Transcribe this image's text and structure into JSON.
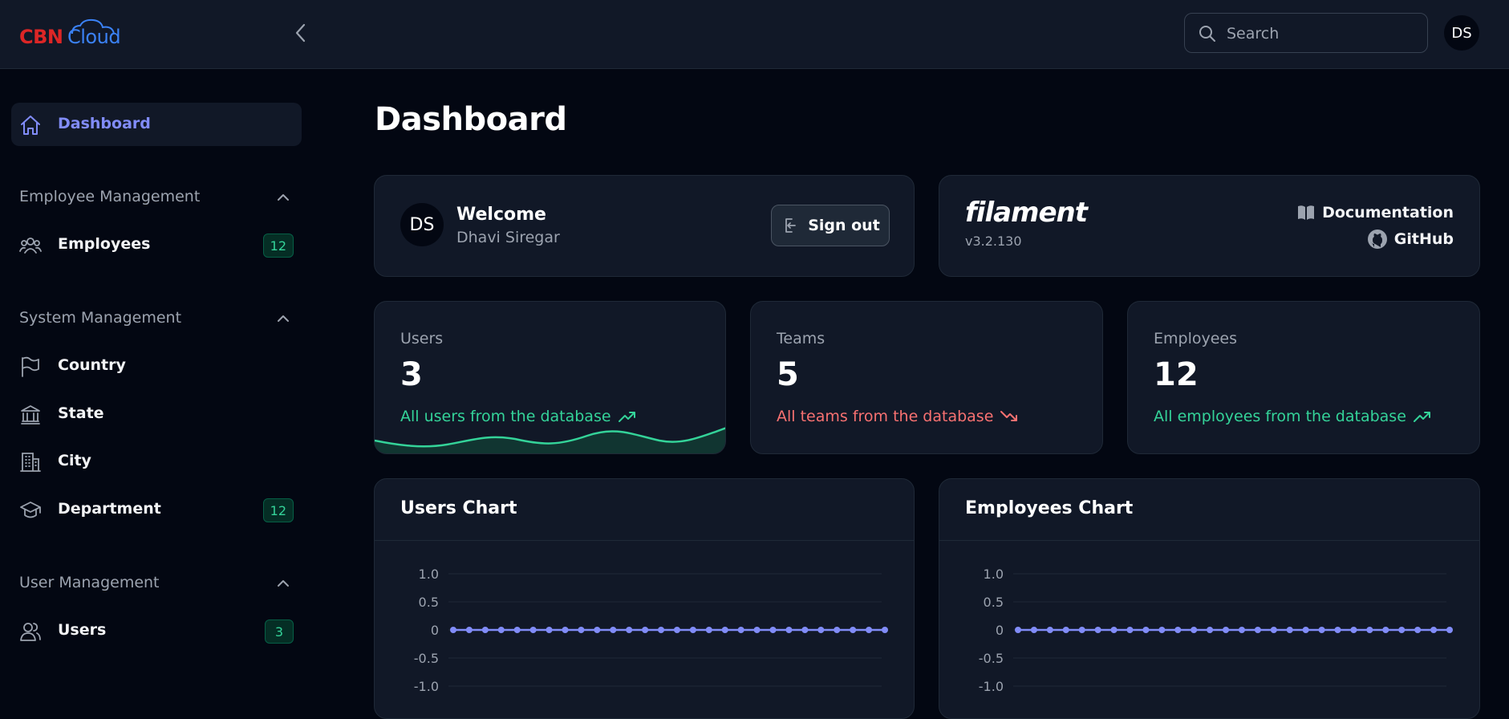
{
  "brand": {
    "part1": "CBN",
    "part2": "Cloud"
  },
  "search": {
    "placeholder": "Search"
  },
  "user": {
    "initials": "DS"
  },
  "sidebar": {
    "dashboard": {
      "label": "Dashboard",
      "icon": "home-icon"
    },
    "groups": [
      {
        "label": "Employee Management",
        "items": [
          {
            "label": "Employees",
            "icon": "users-group-icon",
            "badge": "12"
          }
        ]
      },
      {
        "label": "System Management",
        "items": [
          {
            "label": "Country",
            "icon": "flag-icon",
            "badge": ""
          },
          {
            "label": "State",
            "icon": "building-library-icon",
            "badge": ""
          },
          {
            "label": "City",
            "icon": "office-building-icon",
            "badge": ""
          },
          {
            "label": "Department",
            "icon": "academic-cap-icon",
            "badge": "12"
          }
        ]
      },
      {
        "label": "User Management",
        "items": [
          {
            "label": "Users",
            "icon": "users-icon",
            "badge": "3"
          }
        ]
      }
    ]
  },
  "page": {
    "title": "Dashboard"
  },
  "welcome": {
    "title": "Welcome",
    "name": "Dhavi Siregar",
    "signout_label": "Sign out"
  },
  "filament": {
    "logo": "filament",
    "version": "v3.2.130",
    "documentation_label": "Documentation",
    "github_label": "GitHub"
  },
  "stats": [
    {
      "label": "Users",
      "value": "3",
      "description": "All users from the database",
      "trend": "up",
      "color": "#34d399"
    },
    {
      "label": "Teams",
      "value": "5",
      "description": "All teams from the database",
      "trend": "down",
      "color": "#f87171"
    },
    {
      "label": "Employees",
      "value": "12",
      "description": "All employees from the database",
      "trend": "up",
      "color": "#34d399"
    }
  ],
  "charts": {
    "users_title": "Users Chart",
    "employees_title": "Employees Chart"
  },
  "chart_data": [
    {
      "type": "line",
      "title": "Users Chart",
      "ylim": [
        -1.0,
        1.0
      ],
      "yticks": [
        "1.0",
        "0.5",
        "0",
        "-0.5",
        "-1.0"
      ],
      "series": [
        {
          "values": [
            0,
            0,
            0,
            0,
            0,
            0,
            0,
            0,
            0,
            0,
            0,
            0,
            0,
            0,
            0,
            0,
            0,
            0,
            0,
            0,
            0,
            0,
            0,
            0,
            0,
            0,
            0,
            0
          ]
        }
      ],
      "color": "#818cf8"
    },
    {
      "type": "line",
      "title": "Employees Chart",
      "ylim": [
        -1.0,
        1.0
      ],
      "yticks": [
        "1.0",
        "0.5",
        "0",
        "-0.5",
        "-1.0"
      ],
      "series": [
        {
          "values": [
            0,
            0,
            0,
            0,
            0,
            0,
            0,
            0,
            0,
            0,
            0,
            0,
            0,
            0,
            0,
            0,
            0,
            0,
            0,
            0,
            0,
            0,
            0,
            0,
            0,
            0,
            0,
            0
          ]
        }
      ],
      "color": "#818cf8"
    }
  ]
}
